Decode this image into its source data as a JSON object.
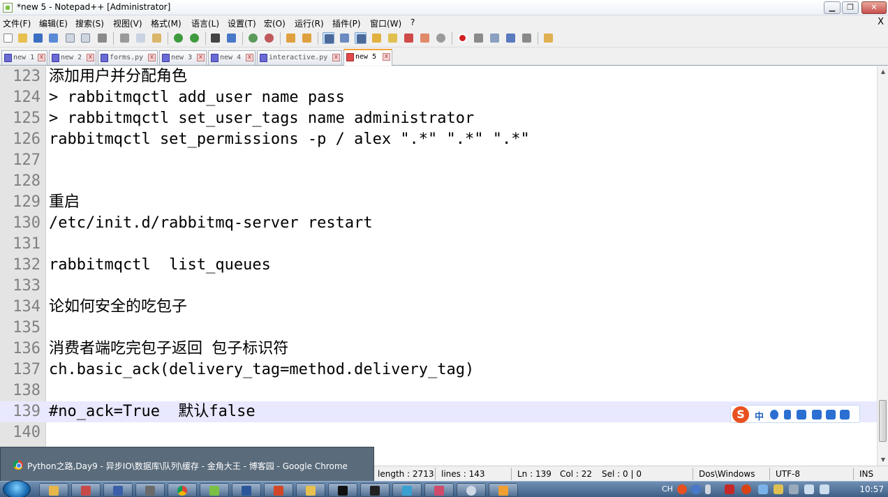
{
  "window": {
    "title": "*new 5 - Notepad++ [Administrator]",
    "min_label": "▁",
    "max_label": "❐",
    "close_label": "✕"
  },
  "menu": [
    "文件(F)",
    "编辑(E)",
    "搜索(S)",
    "视图(V)",
    "格式(M)",
    "语言(L)",
    "设置(T)",
    "宏(O)",
    "运行(R)",
    "插件(P)",
    "窗口(W)",
    "?"
  ],
  "menu_close": "X",
  "toolbar_icons": [
    "new-file",
    "open-file",
    "save",
    "save-all",
    "close",
    "close-all",
    "print",
    "cut",
    "copy",
    "paste",
    "undo",
    "redo",
    "find",
    "replace",
    "zoom-in",
    "zoom-out",
    "sync-vertical",
    "sync-horizontal",
    "word-wrap",
    "show-all-chars",
    "indent-guide",
    "user-defined-language",
    "document-map",
    "function-list",
    "folder-as-workspace",
    "monitoring",
    "record-macro",
    "stop-record",
    "play-macro",
    "run-macro-multiple",
    "save-macro",
    "launch"
  ],
  "tabs": [
    {
      "label": "new 1",
      "active": false
    },
    {
      "label": "new 2",
      "active": false
    },
    {
      "label": "forms.py",
      "active": false
    },
    {
      "label": "new 3",
      "active": false
    },
    {
      "label": "new 4",
      "active": false
    },
    {
      "label": "interactive.py",
      "active": false
    },
    {
      "label": "new 5",
      "active": true
    }
  ],
  "tab_close": "x",
  "editor": {
    "lines": [
      {
        "num": "123",
        "text": "添加用户并分配角色"
      },
      {
        "num": "124",
        "text": "> rabbitmqctl add_user name pass"
      },
      {
        "num": "125",
        "text": "> rabbitmqctl set_user_tags name administrator"
      },
      {
        "num": "126",
        "text": "rabbitmqctl set_permissions -p / alex \".*\" \".*\" \".*\""
      },
      {
        "num": "127",
        "text": ""
      },
      {
        "num": "128",
        "text": ""
      },
      {
        "num": "129",
        "text": "重启"
      },
      {
        "num": "130",
        "text": "/etc/init.d/rabbitmq-server restart"
      },
      {
        "num": "131",
        "text": ""
      },
      {
        "num": "132",
        "text": "rabbitmqctl  list_queues"
      },
      {
        "num": "133",
        "text": ""
      },
      {
        "num": "134",
        "text": "论如何安全的吃包子"
      },
      {
        "num": "135",
        "text": ""
      },
      {
        "num": "136",
        "text": "消费者端吃完包子返回 包子标识符"
      },
      {
        "num": "137",
        "text": "ch.basic_ack(delivery_tag=method.delivery_tag)"
      },
      {
        "num": "138",
        "text": ""
      },
      {
        "num": "139",
        "text": "#no_ack=True  默认false"
      },
      {
        "num": "140",
        "text": ""
      }
    ],
    "current_line": "139"
  },
  "ime": {
    "logo": "S",
    "mode": "中"
  },
  "status": {
    "length": "length : 2713",
    "lines": "lines : 143",
    "ln": "Ln : 139",
    "col": "Col : 22",
    "sel": "Sel : 0 | 0",
    "eol": "Dos\\Windows",
    "encoding": "UTF-8",
    "mode": "INS"
  },
  "tooltip": {
    "text": "Python之路,Day9 - 异步IO\\数据库\\队列\\缓存 - 金角大王 - 博客园 - Google Chrome"
  },
  "taskbar": {
    "apps": [
      "explorer",
      "bird-app",
      "save-app",
      "tools-app",
      "chrome",
      "notepad-plus-plus",
      "word",
      "powerpoint",
      "folder",
      "pycharm",
      "terminal",
      "vm-app",
      "xshell",
      "teamviewer",
      "media-app"
    ],
    "tray_lang": "CH",
    "clock": "10:57"
  },
  "colors": {
    "current_line_bg": "#e8e8ff",
    "gutter_bg": "#e4e4e4",
    "active_tab_accent": "#f2a33a"
  }
}
